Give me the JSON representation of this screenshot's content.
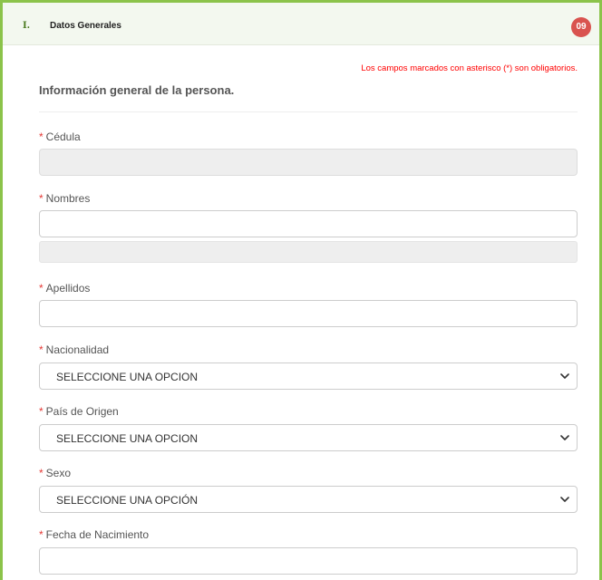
{
  "section": {
    "number": "I.",
    "title": "Datos Generales",
    "badge": "09"
  },
  "form": {
    "required_note": "Los campos marcados con asterisco (*) son obligatorios.",
    "subtitle": "Información general de la persona.",
    "required_marker": "*",
    "fields": {
      "cedula": {
        "label": "Cédula",
        "value": ""
      },
      "nombres": {
        "label": "Nombres",
        "value": ""
      },
      "apellidos": {
        "label": "Apellidos",
        "value": ""
      },
      "nacionalidad": {
        "label": "Nacionalidad",
        "selected": "SELECCIONE UNA OPCION"
      },
      "pais_origen": {
        "label": "País de Origen",
        "selected": "SELECCIONE UNA OPCION"
      },
      "sexo": {
        "label": "Sexo",
        "selected": "SELECCIONE UNA OPCIÓN"
      },
      "fecha_nacimiento": {
        "label": "Fecha de Nacimiento",
        "value": ""
      }
    }
  },
  "colors": {
    "accent_border": "#8bc34a",
    "header_bg": "#f3f8ef",
    "badge_bg": "#d9534f",
    "required": "#e53935"
  },
  "icons": {
    "select_arrow": "chevron-down-icon"
  }
}
